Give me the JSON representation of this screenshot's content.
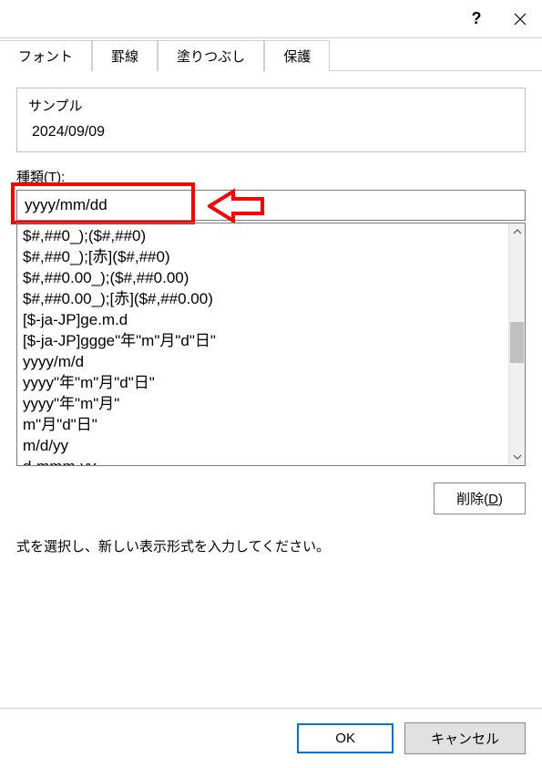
{
  "titlebar": {
    "help": "?",
    "close": "×"
  },
  "tabs": [
    {
      "label": "フォント"
    },
    {
      "label": "罫線"
    },
    {
      "label": "塗りつぶし"
    },
    {
      "label": "保護"
    }
  ],
  "sample": {
    "label": "サンプル",
    "value": "2024/09/09"
  },
  "type": {
    "label_prefix": "種類(",
    "label_key": "T",
    "label_suffix": "):",
    "input_value": "yyyy/mm/dd"
  },
  "list_items": [
    "$#,##0_);($#,##0)",
    "$#,##0_);[赤]($#,##0)",
    "$#,##0.00_);($#,##0.00)",
    "$#,##0.00_);[赤]($#,##0.00)",
    "[$-ja-JP]ge.m.d",
    "[$-ja-JP]ggge\"年\"m\"月\"d\"日\"",
    "yyyy/m/d",
    "yyyy\"年\"m\"月\"d\"日\"",
    "yyyy\"年\"m\"月\"",
    "m\"月\"d\"日\"",
    "m/d/yy",
    "d-mmm-yy"
  ],
  "delete": {
    "label_prefix": "削除(",
    "label_key": "D",
    "label_suffix": ")"
  },
  "description": "式を選択し、新しい表示形式を入力してください。",
  "footer": {
    "ok": "OK",
    "cancel": "キャンセル"
  }
}
